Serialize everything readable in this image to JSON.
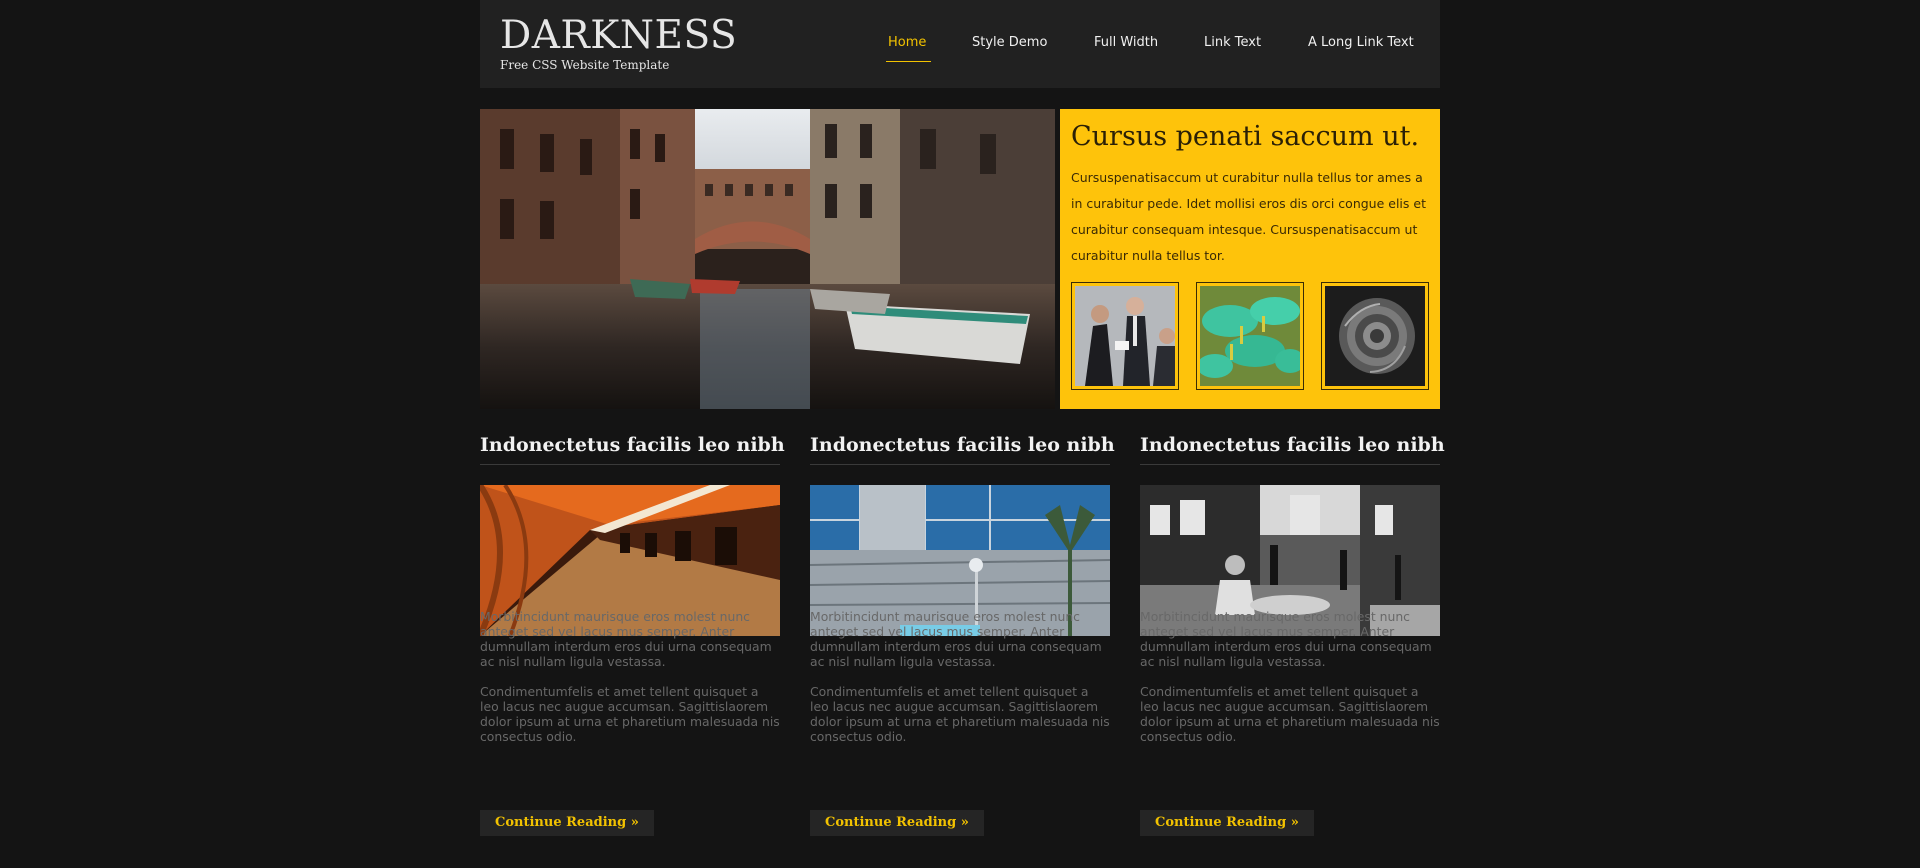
{
  "site": {
    "title": "DARKNESS",
    "subtitle": "Free CSS Website Template"
  },
  "nav": {
    "items": [
      {
        "label": "Home",
        "active": true
      },
      {
        "label": "Style Demo"
      },
      {
        "label": "Full Width"
      },
      {
        "label": "Link Text"
      },
      {
        "label": "A Long Link Text"
      }
    ]
  },
  "promo": {
    "title": "Cursus penati saccum ut.",
    "text": "Cursuspenatisaccum ut curabitur nulla tellus tor ames a in curabitur pede. Idet mollisi eros dis orci congue elis et curabitur consequam intesque. Cursuspenatisaccum ut curabitur nulla tellus tor."
  },
  "columns": [
    {
      "title": "Indonectetus facilis leo nibh",
      "p1": "Morbitincidunt maurisque eros molest nunc anteget sed vel lacus mus semper. Anter dumnullam interdum eros dui urna consequam ac nisl nullam ligula vestassa.",
      "p2": "Condimentumfelis et amet tellent quisquet a leo lacus nec augue accumsan. Sagittislaorem dolor ipsum at urna et pharetium malesuada nis consectus odio.",
      "button": "Continue Reading »"
    },
    {
      "title": "Indonectetus facilis leo nibh",
      "p1": "Morbitincidunt maurisque eros molest nunc anteget sed vel lacus mus semper. Anter dumnullam interdum eros dui urna consequam ac nisl nullam ligula vestassa.",
      "p2": "Condimentumfelis et amet tellent quisquet a leo lacus nec augue accumsan. Sagittislaorem dolor ipsum at urna et pharetium malesuada nis consectus odio.",
      "button": "Continue Reading »"
    },
    {
      "title": "Indonectetus facilis leo nibh",
      "p1": "Morbitincidunt maurisque eros molest nunc anteget sed vel lacus mus semper. Anter dumnullam interdum eros dui urna consequam ac nisl nullam ligula vestassa.",
      "p2": "Condimentumfelis et amet tellent quisquet a leo lacus nec augue accumsan. Sagittislaorem dolor ipsum at urna et pharetium malesuada nis consectus odio.",
      "button": "Continue Reading »"
    }
  ],
  "colors": {
    "accent": "#f2c200",
    "promo_bg": "#fec30b",
    "page_bg": "#141414",
    "header_bg": "#212121"
  }
}
